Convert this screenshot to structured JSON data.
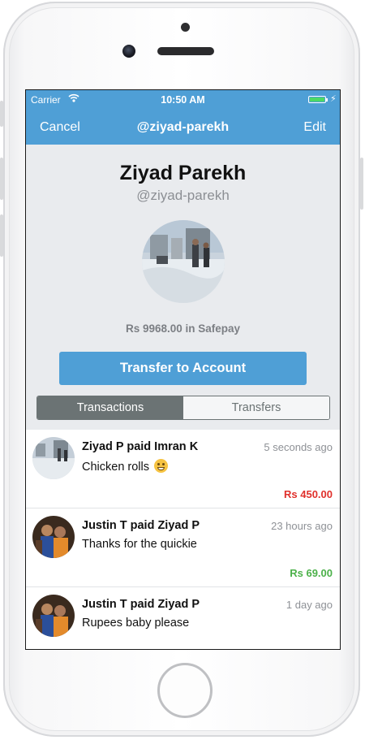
{
  "status_bar": {
    "carrier": "Carrier",
    "time": "10:50 AM"
  },
  "nav": {
    "cancel": "Cancel",
    "title": "@ziyad-parekh",
    "edit": "Edit"
  },
  "profile": {
    "name": "Ziyad Parekh",
    "handle": "@ziyad-parekh",
    "balance": "Rs 9968.00 in Safepay"
  },
  "transfer_button": "Transfer to Account",
  "segments": {
    "transactions": "Transactions",
    "transfers": "Transfers",
    "selected": "Transactions"
  },
  "transactions": [
    {
      "title": "Ziyad P paid Imran K",
      "time": "5 seconds ago",
      "message": "Chicken rolls",
      "amount": "Rs 450.00",
      "amount_color": "#e0312c",
      "emoji": "grinning-face-icon"
    },
    {
      "title": "Justin T paid Ziyad P",
      "time": "23 hours ago",
      "message": "Thanks for the quickie",
      "amount": "Rs 69.00",
      "amount_color": "#4cb14a"
    },
    {
      "title": "Justin T paid Ziyad P",
      "time": "1 day ago",
      "message": "Rupees baby please"
    }
  ],
  "colors": {
    "nav_blue": "#4f9fd6",
    "segment_gray": "#6b7374",
    "screen_bg": "#e9ebee"
  }
}
